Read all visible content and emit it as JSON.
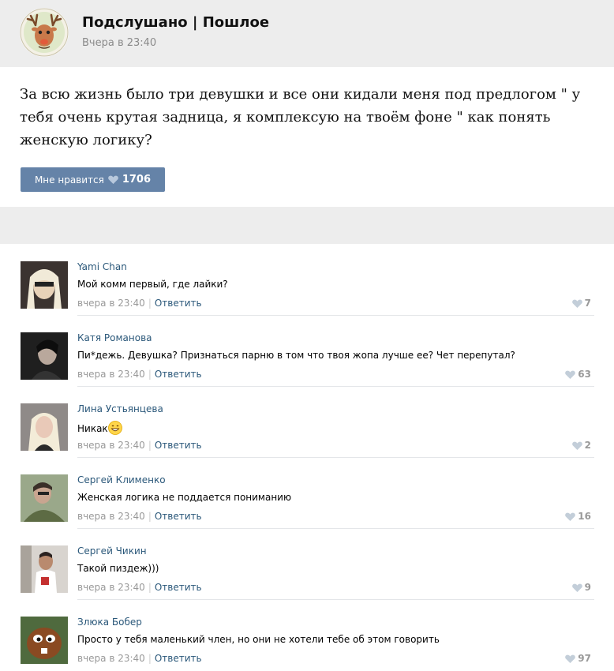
{
  "post": {
    "group_name": "Подслушано | Пошлое",
    "time": "Вчера в 23:40",
    "text": "За всю жизнь было три девушки и все они кидали меня под предлогом \" у тебя очень крутая задница, я комплексую на твоём фоне \" как понять женскую логику?",
    "like_label": "Мне нравится",
    "like_count": "1706",
    "avatar_icon": "deer-logo-icon"
  },
  "colors": {
    "header_bg": "#ededed",
    "like_button": "#6583a8",
    "link": "#2b587a",
    "muted": "#999999"
  },
  "comments": [
    {
      "author": "Yami Chan",
      "text": "Мой комм первый, где лайки?",
      "time": "вчера в 23:40",
      "reply": "Ответить",
      "likes": "7"
    },
    {
      "author": "Катя Романова",
      "text": "Пи*дежь. Девушка? Признаться парню в том что твоя жопа лучше ее? Чет перепутал?",
      "time": "вчера в 23:40",
      "reply": "Ответить",
      "likes": "63"
    },
    {
      "author": "Лина Устьянцева",
      "text": "Никак",
      "time": "вчера в 23:40",
      "reply": "Ответить",
      "likes": "2",
      "emoji": "grinning-smiley-icon"
    },
    {
      "author": "Сергей Клименко",
      "text": "Женская логика не поддается пониманию",
      "time": "вчера в 23:40",
      "reply": "Ответить",
      "likes": "16"
    },
    {
      "author": "Сергей Чикин",
      "text": "Такой пиздеж)))",
      "time": "вчера в 23:40",
      "reply": "Ответить",
      "likes": "9"
    },
    {
      "author": "Злюка Бобер",
      "text": "Просто у тебя маленький член, но они не хотели тебе об этом говорить",
      "time": "вчера в 23:40",
      "reply": "Ответить",
      "likes": "97"
    }
  ]
}
